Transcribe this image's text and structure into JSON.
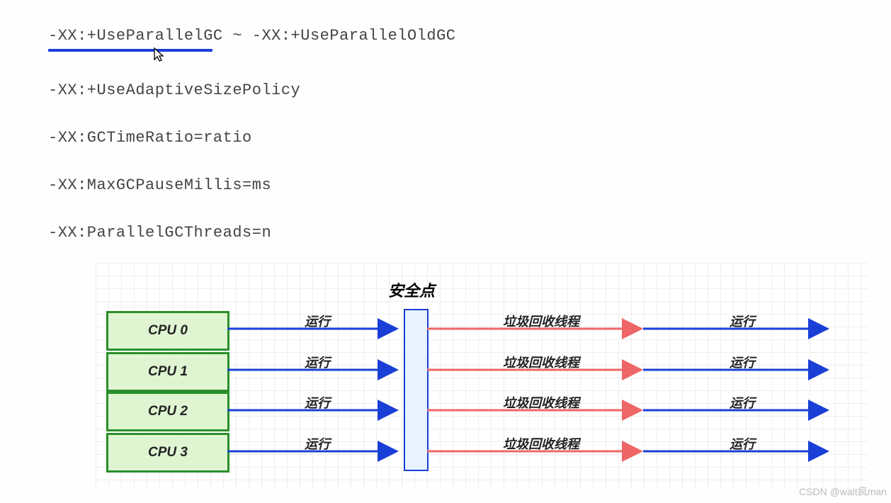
{
  "code": {
    "line1": "-XX:+UseParallelGC ~ -XX:+UseParallelOldGC",
    "line2": "-XX:+UseAdaptiveSizePolicy",
    "line3": "-XX:GCTimeRatio=ratio",
    "line4": "-XX:MaxGCPauseMillis=ms",
    "line5": "-XX:ParallelGCThreads=n"
  },
  "diagram": {
    "safepoint_label": "安全点",
    "cpus": [
      "CPU 0",
      "CPU 1",
      "CPU 2",
      "CPU 3"
    ],
    "run_label": "运行",
    "gc_label": "垃圾回收线程",
    "colors": {
      "blue": "#1a3fd6",
      "red": "#e66",
      "green": "#2a8f2a",
      "safefill": "#e9f2ff"
    },
    "rows_y": [
      93,
      151,
      208,
      266
    ]
  },
  "watermark": "CSDN @wait疯man"
}
